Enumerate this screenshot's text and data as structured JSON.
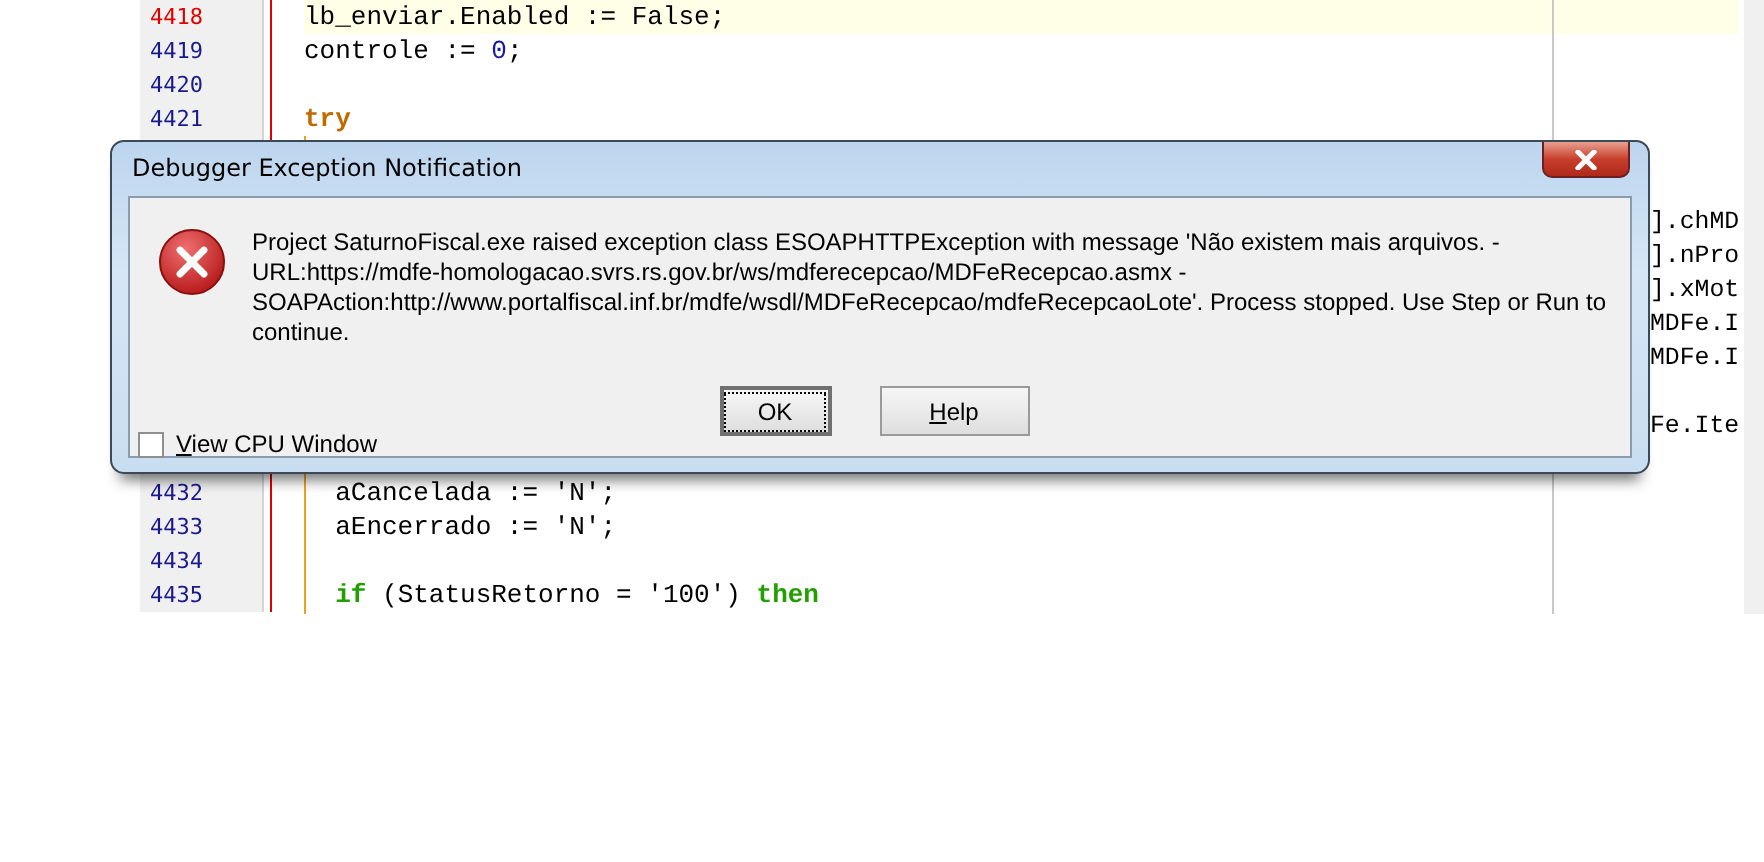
{
  "editor": {
    "rows": [
      {
        "kind": "line",
        "number": "4418",
        "current": true,
        "tokens": [
          {
            "kind": "plain",
            "text": "lb_enviar.Enabled := False;"
          }
        ]
      },
      {
        "kind": "line",
        "number": "4419",
        "current": false,
        "tokens": [
          {
            "kind": "plain",
            "text": "controle := "
          },
          {
            "kind": "number",
            "text": "0"
          },
          {
            "kind": "plain",
            "text": ";"
          }
        ]
      },
      {
        "kind": "line",
        "number": "4420",
        "current": false
      },
      {
        "kind": "line",
        "number": "4421",
        "current": false,
        "tokens": [
          {
            "kind": "block",
            "text": "try"
          }
        ]
      },
      {
        "kind": "hidden"
      },
      {
        "kind": "hidden"
      },
      {
        "kind": "hidden",
        "tail": "].chMD"
      },
      {
        "kind": "hidden",
        "tail": "].nPro"
      },
      {
        "kind": "hidden",
        "tail": "].xMot"
      },
      {
        "kind": "hidden",
        "tail": "MDFe.I"
      },
      {
        "kind": "hidden",
        "tail": "MDFe.I"
      },
      {
        "kind": "hidden"
      },
      {
        "kind": "hidden",
        "tail": "Fe.Ite"
      },
      {
        "kind": "hidden"
      },
      {
        "kind": "line",
        "number": "4432",
        "current": false,
        "tokens": [
          {
            "kind": "plain",
            "text": "  aCancelada := 'N';"
          }
        ]
      },
      {
        "kind": "line",
        "number": "4433",
        "current": false,
        "tokens": [
          {
            "kind": "plain",
            "text": "  aEncerrado := 'N';"
          }
        ]
      },
      {
        "kind": "line",
        "number": "4434",
        "current": false
      },
      {
        "kind": "line",
        "number": "4435",
        "current": false,
        "tokens": [
          {
            "kind": "keyword",
            "text": "  if"
          },
          {
            "kind": "plain",
            "text": " (StatusRetorno = '100') "
          },
          {
            "kind": "keyword",
            "text": "then"
          }
        ]
      }
    ]
  },
  "dialog": {
    "title": "Debugger Exception Notification",
    "message": [
      "Project SaturnoFiscal.exe raised exception class ESOAPHTTPException with message 'Não existem mais arquivos. -",
      "URL:https://mdfe-homologacao.svrs.rs.gov.br/ws/mdferecepcao/MDFeRecepcao.asmx -",
      "SOAPAction:http://www.portalfiscal.inf.br/mdfe/wsdl/MDFeRecepcao/mdfeRecepcaoLote'. Process stopped. Use Step or Run to",
      "continue."
    ],
    "buttons": [
      {
        "label": "OK",
        "focused": true
      },
      {
        "label": "Help",
        "focused": false
      }
    ],
    "checkbox": {
      "label": "View CPU Window",
      "checked": false
    }
  }
}
